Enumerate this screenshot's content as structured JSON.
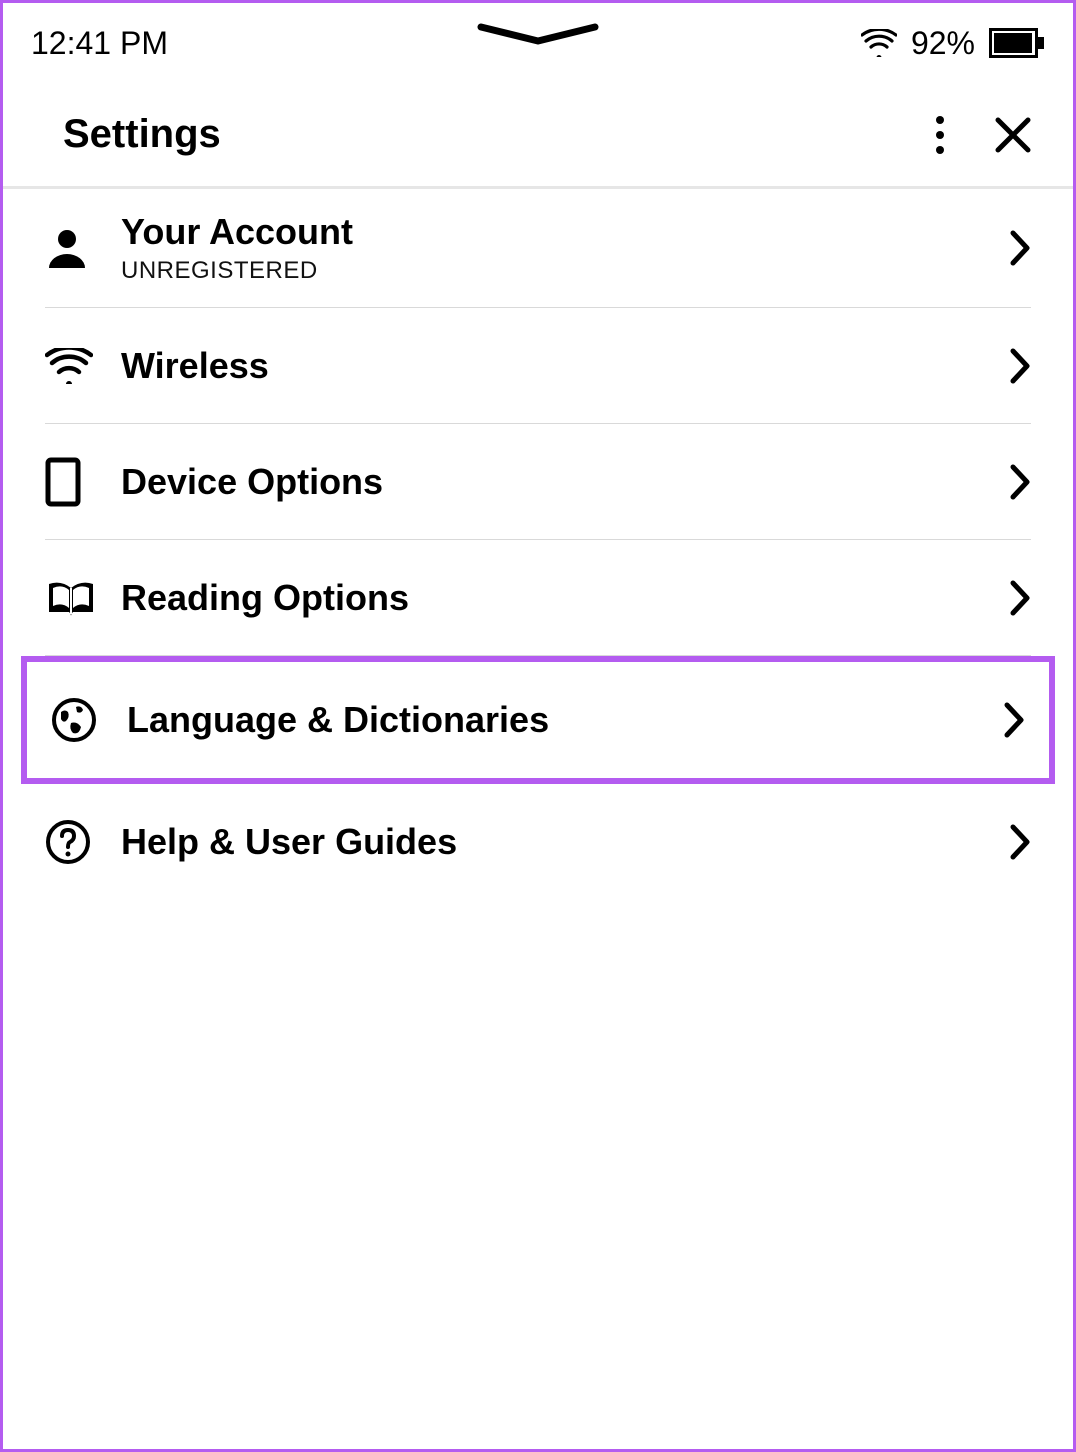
{
  "statusbar": {
    "time": "12:41 PM",
    "battery_pct": "92%"
  },
  "header": {
    "title": "Settings"
  },
  "rows": {
    "account": {
      "title": "Your Account",
      "subtitle": "UNREGISTERED"
    },
    "wireless": {
      "title": "Wireless"
    },
    "device": {
      "title": "Device Options"
    },
    "reading": {
      "title": "Reading Options"
    },
    "language": {
      "title": "Language & Dictionaries"
    },
    "help": {
      "title": "Help & User Guides"
    }
  }
}
